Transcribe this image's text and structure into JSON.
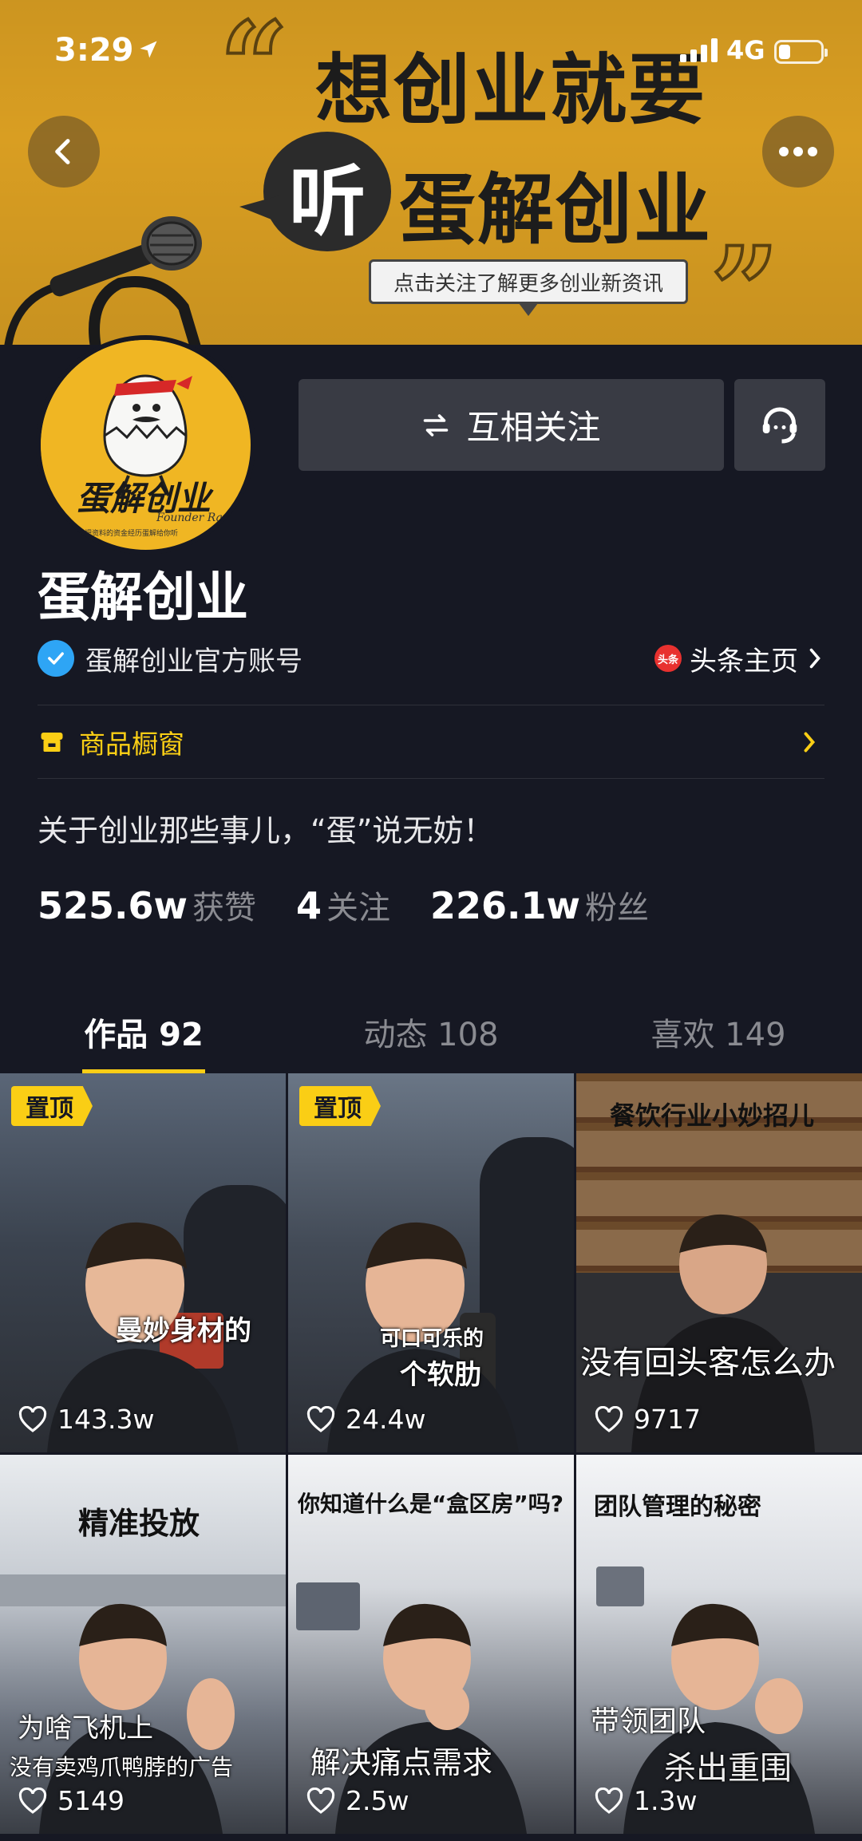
{
  "status_bar": {
    "time": "3:29",
    "network": "4G"
  },
  "banner": {
    "line1": "想创业就要",
    "ting": "听",
    "line2": "蛋解创业",
    "cta": "点击关注了解更多创业新资讯",
    "quote_open": "“",
    "quote_close": "”"
  },
  "avatar": {
    "brand": "蛋解创业",
    "sub": "Founder Radio",
    "tiny": "把资料的资金经历蛋解给你听"
  },
  "actions": {
    "follow_label": "互相关注",
    "follow_icon": "mutual-follow-icon",
    "cs_icon": "customer-service-icon"
  },
  "profile": {
    "name": "蛋解创业",
    "verified_text": "蛋解创业官方账号",
    "toutiao_logo": "头条",
    "toutiao_label": "头条主页",
    "shop_label": "商品橱窗",
    "bio": "关于创业那些事儿，“蛋”说无妨！"
  },
  "stats": [
    {
      "num": "525.6w",
      "label": "获赞"
    },
    {
      "num": "4",
      "label": "关注"
    },
    {
      "num": "226.1w",
      "label": "粉丝"
    }
  ],
  "tabs": [
    {
      "label": "作品 92",
      "active": true
    },
    {
      "label": "动态 108",
      "active": false
    },
    {
      "label": "喜欢 149",
      "active": false
    }
  ],
  "videos": [
    {
      "pin": "置顶",
      "caption1": "曼妙身材的",
      "caption2": "",
      "likes": "143.3w"
    },
    {
      "pin": "置顶",
      "caption1": "可口可乐的",
      "caption2": "个软肋",
      "likes": "24.4w"
    },
    {
      "pin": "",
      "caption1": "餐饮行业小妙招儿",
      "caption2": "没有回头客怎么办",
      "likes": "9717"
    },
    {
      "pin": "",
      "caption1": "精准投放",
      "caption2": "为啥飞机上",
      "caption3": "没有卖鸡爪鸭脖的广告",
      "likes": "5149"
    },
    {
      "pin": "",
      "caption1": "你知道什么是“盒区房”吗?",
      "caption2": "解决痛点需求",
      "likes": "2.5w"
    },
    {
      "pin": "",
      "caption1": "团队管理的秘密",
      "caption2": "带领团队",
      "caption3": "杀出重围",
      "likes": "1.3w"
    }
  ],
  "colors": {
    "bg": "#161823",
    "accent": "#face15",
    "banner": "#d99e22",
    "button": "#393b44"
  }
}
